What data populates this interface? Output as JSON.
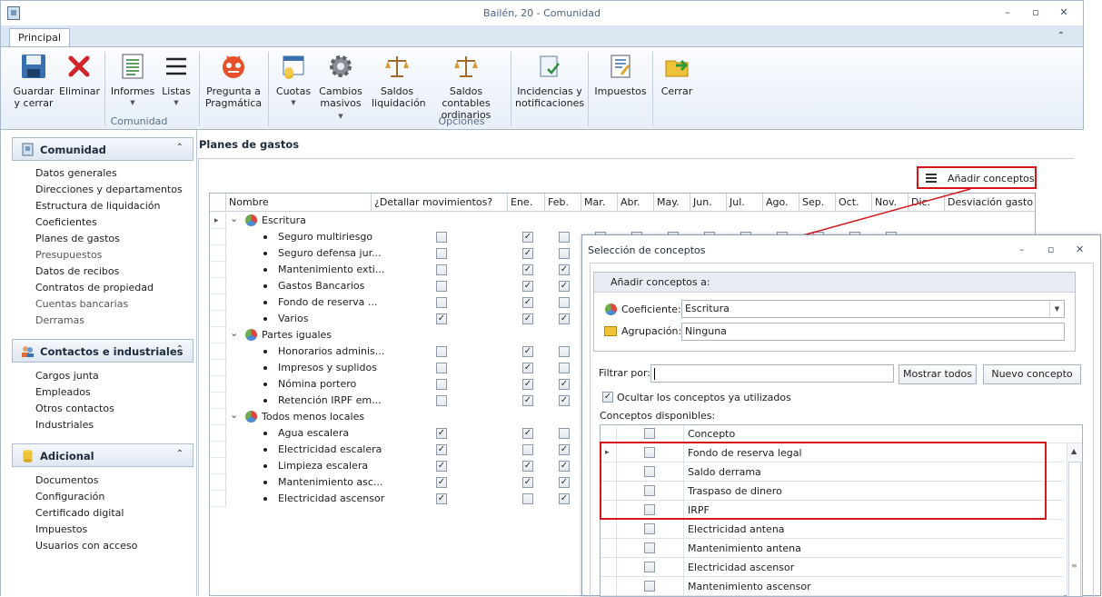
{
  "window": {
    "title": "Bailén, 20 - Comunidad",
    "minimize": "–",
    "restore": "▫",
    "close": "✕"
  },
  "ribbon": {
    "tab": "Principal",
    "collapse": "⌃",
    "buttons": [
      {
        "line1": "Guardar",
        "line2": "y cerrar",
        "icon": "save-icon"
      },
      {
        "line1": "Eliminar",
        "line2": "",
        "icon": "delete-icon"
      },
      {
        "line1": "Informes",
        "line2": "",
        "icon": "report-icon"
      },
      {
        "line1": "Listas",
        "line2": "",
        "icon": "list-icon"
      },
      {
        "line1": "Pregunta a",
        "line2": "Pragmática",
        "icon": "robot-icon"
      },
      {
        "line1": "Cuotas",
        "line2": "",
        "icon": "calendar-coins-icon"
      },
      {
        "line1": "Cambios",
        "line2": "masivos",
        "icon": "gear-icon"
      },
      {
        "line1": "Saldos",
        "line2": "liquidación",
        "icon": "scales-icon"
      },
      {
        "line1": "Saldos contables",
        "line2": "ordinarios",
        "icon": "scales-icon"
      },
      {
        "line1": "Incidencias y",
        "line2": "notificaciones",
        "icon": "clipboard-check-icon"
      },
      {
        "line1": "Impuestos",
        "line2": "",
        "icon": "tax-icon"
      },
      {
        "line1": "Cerrar",
        "line2": "",
        "icon": "folder-exit-icon"
      }
    ],
    "groups": {
      "comunidad": "Comunidad",
      "opciones": "Opciones"
    }
  },
  "sidebar": {
    "comunidad": {
      "title": "Comunidad",
      "items": [
        "Datos generales",
        "Direcciones y departamentos",
        "Estructura de liquidación",
        "Coeficientes",
        "Planes de gastos",
        "Presupuestos",
        "Datos de recibos",
        "Contratos de propiedad",
        "Cuentas bancarias",
        "Derramas"
      ]
    },
    "contactos": {
      "title": "Contactos e industriales",
      "items": [
        "Cargos junta",
        "Empleados",
        "Otros contactos",
        "Industriales"
      ]
    },
    "adicional": {
      "title": "Adicional",
      "items": [
        "Documentos",
        "Configuración",
        "Certificado digital",
        "Impuestos",
        "Usuarios con acceso"
      ]
    }
  },
  "content": {
    "title": "Planes de gastos",
    "add_button": "Añadir conceptos",
    "columns": [
      "Nombre",
      "¿Detallar movimientos?",
      "Ene.",
      "Feb.",
      "Mar.",
      "Abr.",
      "May.",
      "Jun.",
      "Jul.",
      "Ago.",
      "Sep.",
      "Oct.",
      "Nov.",
      "Dic.",
      "Desviación gasto ar"
    ],
    "rows": [
      {
        "type": "group",
        "name": "Escritura"
      },
      {
        "type": "item",
        "name": "Seguro multiriesgo",
        "det": false,
        "ene": true,
        "feb": false
      },
      {
        "type": "item",
        "name": "Seguro defensa jur...",
        "det": false,
        "ene": true,
        "feb": false
      },
      {
        "type": "item",
        "name": "Mantenimiento exti...",
        "det": false,
        "ene": true,
        "feb": true
      },
      {
        "type": "item",
        "name": "Gastos Bancarios",
        "det": false,
        "ene": true,
        "feb": true
      },
      {
        "type": "item",
        "name": "Fondo de reserva ...",
        "det": false,
        "ene": true,
        "feb": false
      },
      {
        "type": "item",
        "name": "Varios",
        "det": true,
        "ene": true,
        "feb": true
      },
      {
        "type": "group",
        "name": "Partes iguales"
      },
      {
        "type": "item",
        "name": "Honorarios adminis...",
        "det": false,
        "ene": true,
        "feb": false
      },
      {
        "type": "item",
        "name": "Impresos y suplidos",
        "det": false,
        "ene": true,
        "feb": false
      },
      {
        "type": "item",
        "name": "Nómina portero",
        "det": false,
        "ene": true,
        "feb": true
      },
      {
        "type": "item",
        "name": "Retención IRPF em...",
        "det": false,
        "ene": true,
        "feb": true
      },
      {
        "type": "group",
        "name": "Todos menos locales"
      },
      {
        "type": "item",
        "name": "Agua escalera",
        "det": true,
        "ene": true,
        "feb": false
      },
      {
        "type": "item",
        "name": "Electricidad escalera",
        "det": true,
        "ene": false,
        "feb": true
      },
      {
        "type": "item",
        "name": "Limpieza escalera",
        "det": true,
        "ene": true,
        "feb": true
      },
      {
        "type": "item",
        "name": "Mantenimiento asc...",
        "det": true,
        "ene": true,
        "feb": true
      },
      {
        "type": "item",
        "name": "Electricidad ascensor",
        "det": true,
        "ene": false,
        "feb": true
      }
    ]
  },
  "dialog": {
    "title": "Selección de conceptos",
    "group_title": "Añadir conceptos a:",
    "coef_label": "Coeficiente:",
    "coef_value": "Escritura",
    "agrup_label": "Agrupación:",
    "agrup_value": "Ninguna",
    "filter_label": "Filtrar por:",
    "filter_value": "",
    "btn_show_all": "Mostrar todos",
    "btn_new": "Nuevo concepto",
    "hide_used_label": "Ocultar los conceptos ya utilizados",
    "hide_used": true,
    "available_label": "Conceptos disponibles:",
    "col_concept": "Concepto",
    "concepts": [
      "Fondo de reserva legal",
      "Saldo derrama",
      "Traspaso de dinero",
      "IRPF",
      "Electricidad antena",
      "Mantenimiento antena",
      "Electricidad ascensor",
      "Mantenimiento ascensor"
    ]
  },
  "colors": {
    "highlight": "#d6151b",
    "title_text": "#4b6487"
  }
}
